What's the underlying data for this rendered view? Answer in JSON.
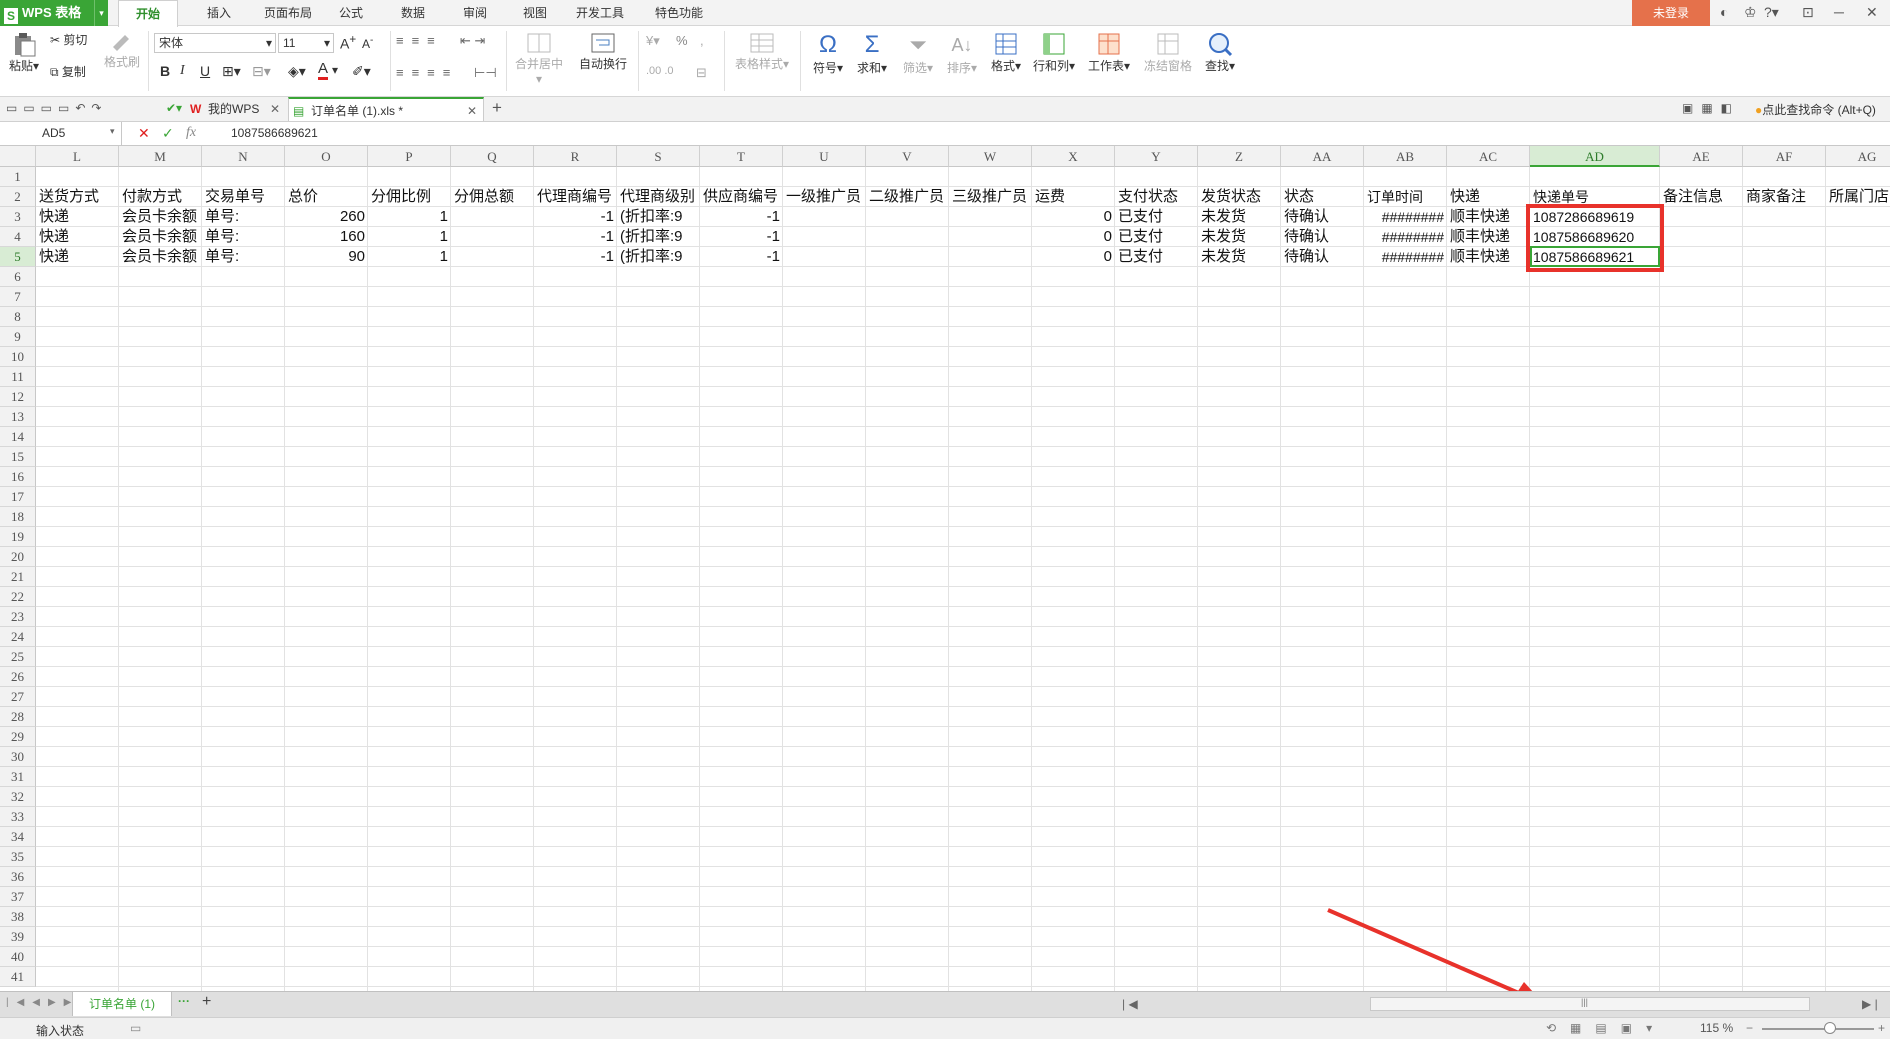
{
  "app": {
    "name": "WPS 表格",
    "logo": "S"
  },
  "menu_tabs": [
    "开始",
    "插入",
    "页面布局",
    "公式",
    "数据",
    "审阅",
    "视图",
    "开发工具",
    "特色功能"
  ],
  "login_label": "未登录",
  "ribbon": {
    "paste": "粘贴",
    "cut": "剪切",
    "copy": "复制",
    "format_painter": "格式刷",
    "font_name": "宋体",
    "font_size": "11",
    "merge_center": "合并居中",
    "wrap_text": "自动换行",
    "table_style": "表格样式",
    "symbol": "符号",
    "sum": "求和",
    "filter": "筛选",
    "sort": "排序",
    "format": "格式",
    "row_col": "行和列",
    "worksheet": "工作表",
    "freeze": "冻结窗格",
    "find": "查找",
    "percent": "%",
    "bold": "B",
    "italic": "I",
    "underline": "U"
  },
  "doc_tabs": [
    {
      "label": "我的WPS"
    },
    {
      "label": "订单名单 (1).xls *"
    }
  ],
  "search_hint": "点此查找命令 (Alt+Q)",
  "name_box": "AD5",
  "formula_value": "1087586689621",
  "columns": [
    "L",
    "M",
    "N",
    "O",
    "P",
    "Q",
    "R",
    "S",
    "T",
    "U",
    "V",
    "W",
    "X",
    "Y",
    "Z",
    "AA",
    "AB",
    "AC",
    "AD",
    "AE",
    "AF",
    "AG"
  ],
  "selected_column": "AD",
  "row_count": 41,
  "selected_row": 5,
  "header_row": [
    "送货方式",
    "付款方式",
    "交易单号",
    "总价",
    "分佣比例",
    "分佣总额",
    "代理商编号",
    "代理商级别",
    "供应商编号",
    "一级推广员",
    "二级推广员",
    "三级推广员",
    "运费",
    "支付状态",
    "发货状态",
    "状态",
    "订单时间",
    "快递",
    "快递单号",
    "备注信息",
    "商家备注",
    "所属门店"
  ],
  "data_rows": [
    [
      "快递",
      "会员卡余额",
      "单号:",
      "260",
      "1",
      "",
      "-1",
      "(折扣率:9",
      "-1",
      "",
      "",
      "",
      "0",
      "已支付",
      "未发货",
      "待确认",
      "########",
      "顺丰快递",
      "1087286689619",
      "",
      "",
      ""
    ],
    [
      "快递",
      "会员卡余额",
      "单号:",
      "160",
      "1",
      "",
      "-1",
      "(折扣率:9",
      "-1",
      "",
      "",
      "",
      "0",
      "已支付",
      "未发货",
      "待确认",
      "########",
      "顺丰快递",
      "1087586689620",
      "",
      "",
      ""
    ],
    [
      "快递",
      "会员卡余额",
      "单号:",
      "90",
      "1",
      "",
      "-1",
      "(折扣率:9",
      "-1",
      "",
      "",
      "",
      "0",
      "已支付",
      "未发货",
      "待确认",
      "########",
      "顺丰快递",
      "1087586689621",
      "",
      "",
      ""
    ]
  ],
  "sheet_tab": "订单名单 (1)",
  "status_text": "输入状态",
  "zoom": "115 %",
  "colors": {
    "accent_green": "#3aa536",
    "highlight_red": "#e8322b",
    "login_orange": "#e5714b"
  }
}
